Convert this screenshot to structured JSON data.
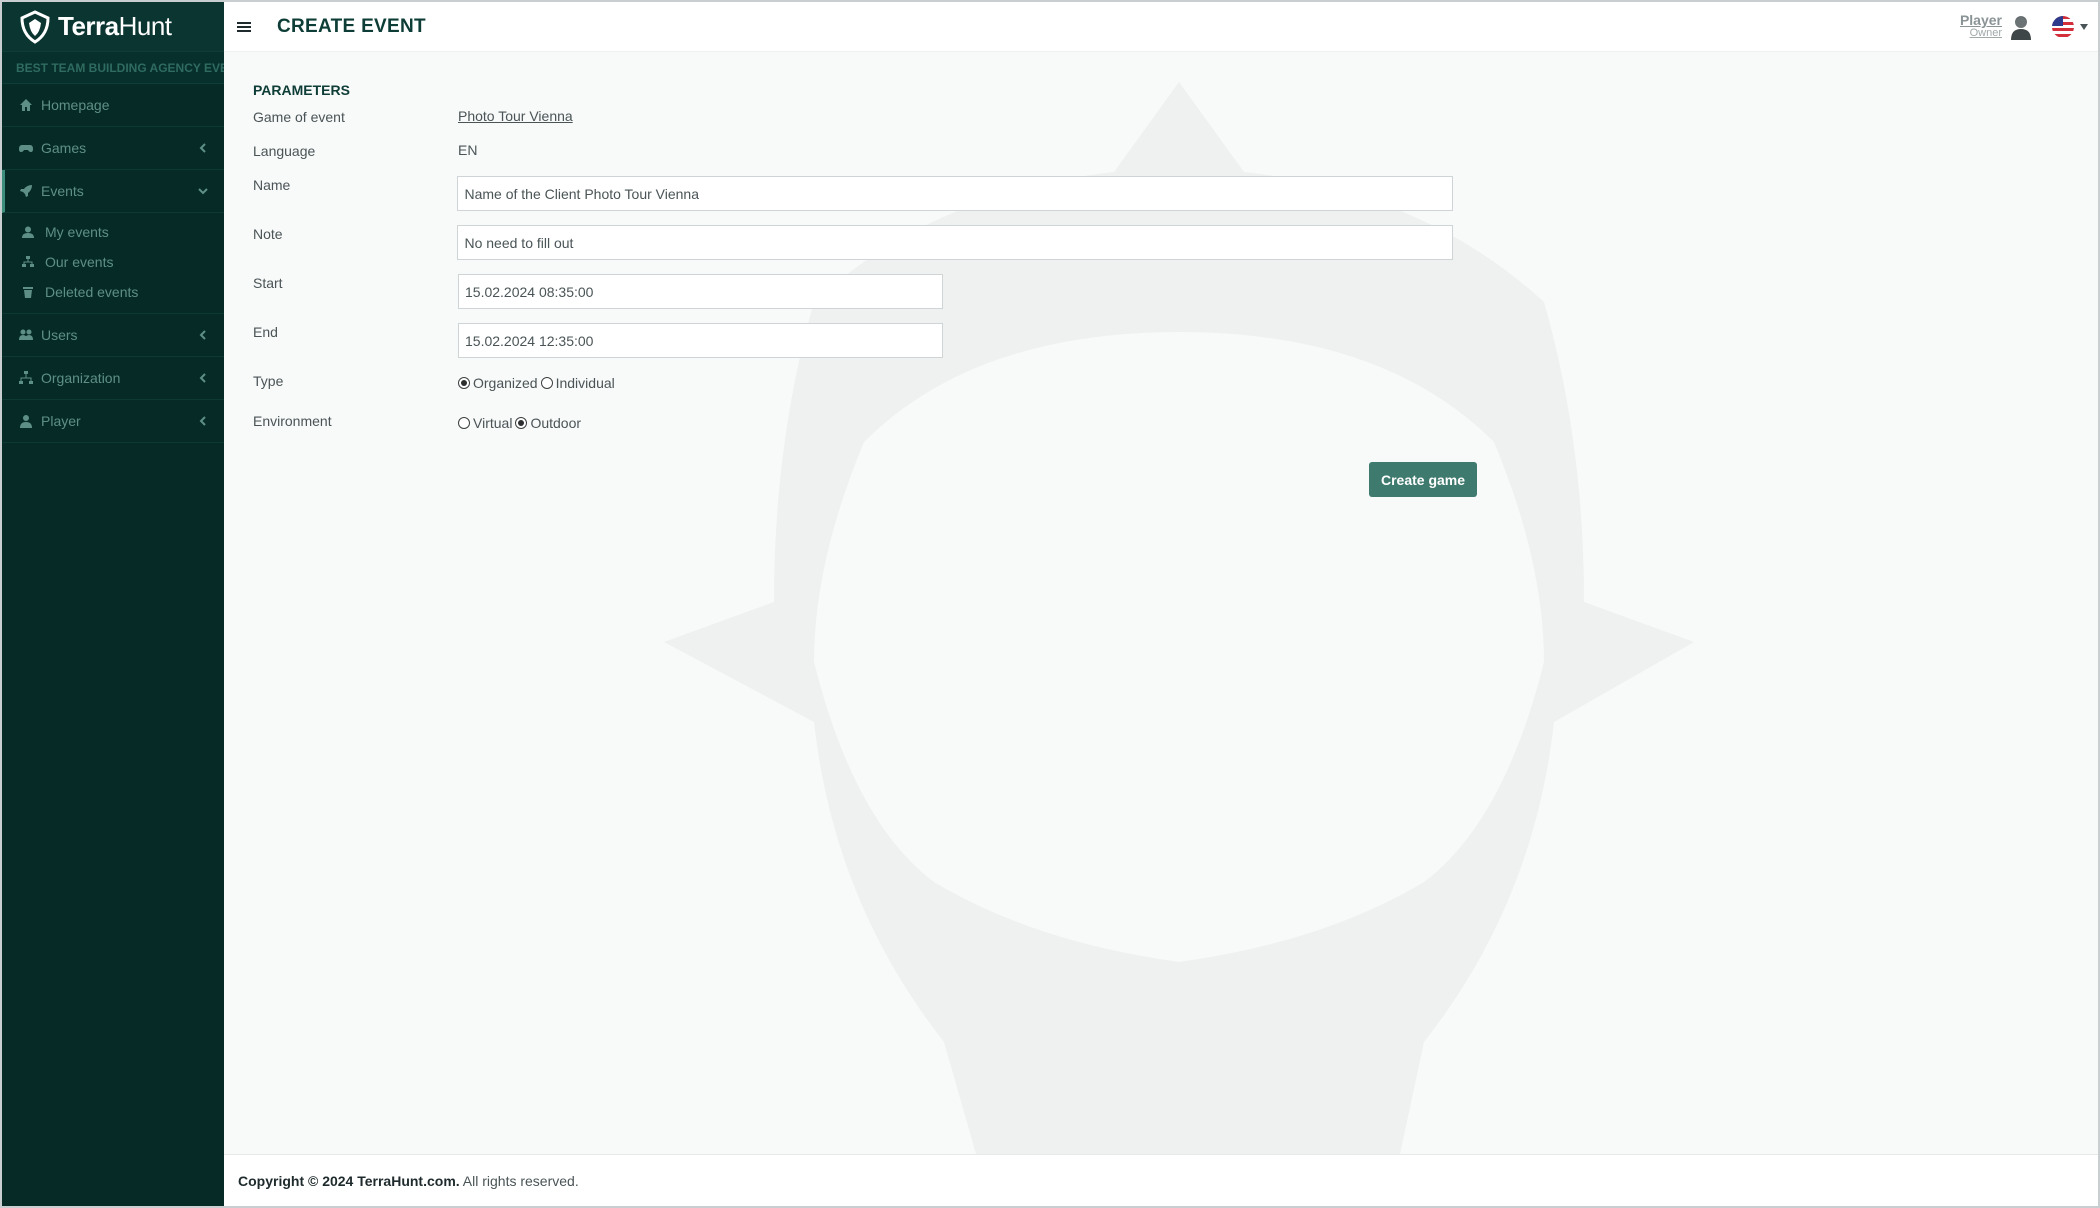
{
  "brand": {
    "name_bold": "Terra",
    "name_light": "Hunt",
    "tagline": "BEST TEAM BUILDING AGENCY EVER"
  },
  "sidebar": {
    "items": [
      {
        "label": "Homepage",
        "icon": "home-icon"
      },
      {
        "label": "Games",
        "icon": "gamepad-icon"
      },
      {
        "label": "Events",
        "icon": "rocket-icon"
      },
      {
        "label": "Users",
        "icon": "users-icon"
      },
      {
        "label": "Organization",
        "icon": "sitemap-icon"
      },
      {
        "label": "Player",
        "icon": "user-icon"
      }
    ],
    "events_sub": [
      {
        "label": "My events",
        "icon": "user-icon"
      },
      {
        "label": "Our events",
        "icon": "sitemap-icon"
      },
      {
        "label": "Deleted events",
        "icon": "trash-icon"
      }
    ]
  },
  "header": {
    "title": "CREATE EVENT",
    "user_name": "Player",
    "user_role": "Owner",
    "language_flag": "us-flag-icon"
  },
  "form": {
    "section_title": "PARAMETERS",
    "game_label": "Game of event",
    "game_value": "Photo Tour Vienna",
    "language_label": "Language",
    "language_value": "EN",
    "name_label": "Name",
    "name_value": "Name of the Client Photo Tour Vienna",
    "note_label": "Note",
    "note_value": "No need to fill out",
    "start_label": "Start",
    "start_value": "15.02.2024 08:35:00",
    "end_label": "End",
    "end_value": "15.02.2024 12:35:00",
    "type_label": "Type",
    "type_options": [
      "Organized",
      "Individual"
    ],
    "type_selected": "Organized",
    "environment_label": "Environment",
    "environment_options": [
      "Virtual",
      "Outdoor"
    ],
    "environment_selected": "Outdoor",
    "submit_label": "Create game"
  },
  "footer": {
    "copyright_bold": "Copyright © 2024 TerraHunt.com.",
    "copyright_rest": " All rights reserved."
  },
  "colors": {
    "sidebar_bg": "#062b27",
    "accent": "#3f7a6e",
    "title": "#0d3d36"
  }
}
